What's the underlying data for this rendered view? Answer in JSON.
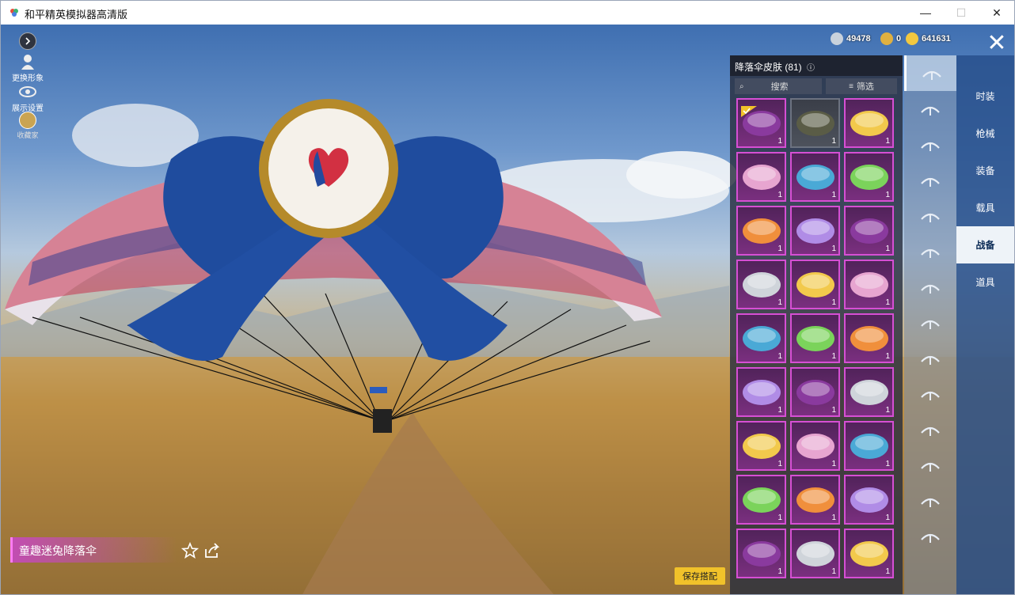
{
  "window": {
    "title": "和平精英模拟器高清版",
    "min": "—",
    "max": "☐",
    "close": "✕"
  },
  "left_menu": {
    "play_label": "",
    "change_avatar": "更换形象",
    "display_settings": "展示设置",
    "collection": "收藏家"
  },
  "currency": [
    {
      "icon": "silver-coin-icon",
      "value": "49478",
      "color": "#c9d2dc"
    },
    {
      "icon": "token-icon",
      "value": "0",
      "color": "#e0b040"
    },
    {
      "icon": "gold-coin-icon",
      "value": "641631",
      "color": "#f2c840"
    }
  ],
  "panel": {
    "title": "降落伞皮肤 (81)",
    "search_label": "搜索",
    "filter_label": "筛选",
    "items": [
      {
        "count": "1",
        "style": "purple",
        "selected": true
      },
      {
        "count": "1",
        "style": "gray",
        "selected": false
      },
      {
        "count": "1",
        "style": "purple",
        "selected": false
      },
      {
        "count": "1",
        "style": "purple",
        "selected": false
      },
      {
        "count": "1",
        "style": "purple",
        "selected": false
      },
      {
        "count": "1",
        "style": "purple",
        "selected": false
      },
      {
        "count": "1",
        "style": "purple",
        "selected": false
      },
      {
        "count": "1",
        "style": "purple",
        "selected": false
      },
      {
        "count": "1",
        "style": "purple",
        "selected": false
      },
      {
        "count": "1",
        "style": "purple",
        "selected": false
      },
      {
        "count": "1",
        "style": "purple",
        "selected": false
      },
      {
        "count": "1",
        "style": "purple",
        "selected": false
      },
      {
        "count": "1",
        "style": "purple",
        "selected": false
      },
      {
        "count": "1",
        "style": "purple",
        "selected": false
      },
      {
        "count": "1",
        "style": "purple",
        "selected": false
      },
      {
        "count": "1",
        "style": "purple",
        "selected": false
      },
      {
        "count": "1",
        "style": "purple",
        "selected": false
      },
      {
        "count": "1",
        "style": "purple",
        "selected": false
      },
      {
        "count": "1",
        "style": "purple",
        "selected": false
      },
      {
        "count": "1",
        "style": "purple",
        "selected": false
      },
      {
        "count": "1",
        "style": "purple",
        "selected": false
      },
      {
        "count": "1",
        "style": "purple",
        "selected": false
      },
      {
        "count": "1",
        "style": "purple",
        "selected": false
      },
      {
        "count": "1",
        "style": "purple",
        "selected": false
      },
      {
        "count": "1",
        "style": "purple",
        "selected": false
      },
      {
        "count": "1",
        "style": "purple",
        "selected": false
      },
      {
        "count": "1",
        "style": "purple",
        "selected": false
      }
    ]
  },
  "categories": [
    "时装",
    "枪械",
    "装备",
    "载具",
    "战备",
    "道具"
  ],
  "active_category": "战备",
  "side_icons": [
    "parachute-icon",
    "airplane-trail-icon",
    "drone-icon",
    "glider-icon",
    "emote-face-icon",
    "plane-icon",
    "backpack-icon",
    "speaker-icon",
    "badge-icon",
    "photo-icon",
    "extinguisher-icon",
    "hand-gesture-icon",
    "magic-wand-icon",
    "ufo-icon"
  ],
  "item_name": "童趣迷兔降落伞",
  "save_button": "保存搭配",
  "colors": {
    "rarity_border": "#d64fd4",
    "nav_bg": "#2a5a9a",
    "save_button": "#f1c22a"
  }
}
